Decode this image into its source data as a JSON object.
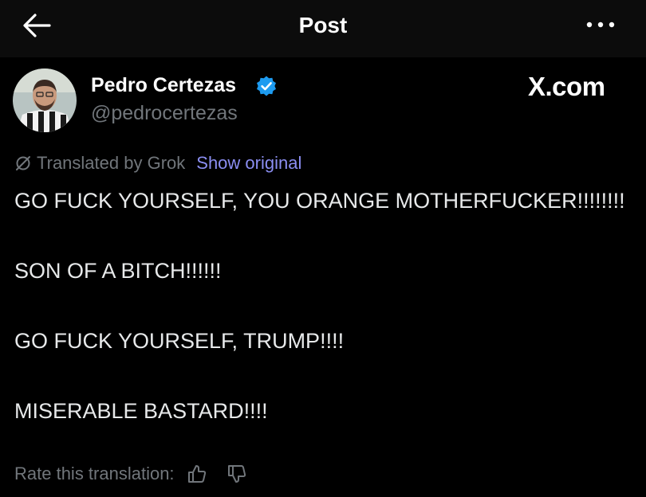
{
  "header": {
    "title": "Post",
    "back_icon": "arrow-left-icon",
    "more_icon": "more-horizontal-icon"
  },
  "author": {
    "name": "Pedro Certezas",
    "handle": "@pedrocertezas",
    "verified": true,
    "verified_color": "#1d9bf0"
  },
  "watermark": "X.com",
  "translation": {
    "label": "Translated by Grok",
    "show_original": "Show original",
    "icon": "translate-slash-icon",
    "link_color": "#8b8ef2"
  },
  "post": {
    "paragraphs": [
      "GO FUCK YOURSELF, YOU ORANGE MOTHERFUCKER!!!!!!!!",
      "SON OF A BITCH!!!!!!",
      "GO FUCK YOURSELF, TRUMP!!!!",
      "MISERABLE BASTARD!!!!"
    ]
  },
  "rating": {
    "label": "Rate this translation:",
    "up_icon": "thumbs-up-icon",
    "down_icon": "thumbs-down-icon"
  }
}
